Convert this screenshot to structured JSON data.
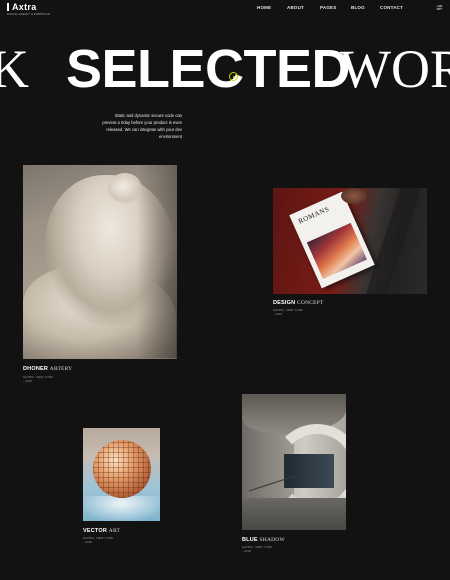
{
  "header": {
    "logo": "Axtra",
    "logo_tagline": "DIGITAL AGENCY & PORTFOLIO",
    "nav": [
      "HOME",
      "ABOUT",
      "PAGES",
      "BLOG",
      "CONTACT"
    ],
    "menu_icon": "filter-menu-icon"
  },
  "hero": {
    "marquee_left": "K",
    "marquee_main": "SELECTED",
    "marquee_right": "WOR",
    "intro": "Static and dynamic secure code can prevent a 0day before your product is even released. We can integrate with your dev environment"
  },
  "projects": [
    {
      "title_bold": "DHONER",
      "title_light": "ARTERY",
      "location": "HATRIC, NEW YORK",
      "year": "- 2018",
      "image": "marble-sculpture"
    },
    {
      "title_bold": "DESIGN",
      "title_light": "CONCEPT",
      "location": "HATRIC, NEW YORK",
      "year": "- 2018",
      "image": "magazine-romans"
    },
    {
      "title_bold": "VECTOR",
      "title_light": "ART",
      "location": "HATRIC, NEW YORK",
      "year": "- 2018",
      "image": "disco-ball"
    },
    {
      "title_bold": "BLUE",
      "title_light": "SHADOW",
      "location": "HATRIC, NEW YORK",
      "year": "- 2018",
      "image": "spiral-stairs"
    }
  ],
  "magazine_cover_text": "ROMANS",
  "colors": {
    "background": "#121212",
    "accent": "#c9d400",
    "text": "#ffffff"
  }
}
